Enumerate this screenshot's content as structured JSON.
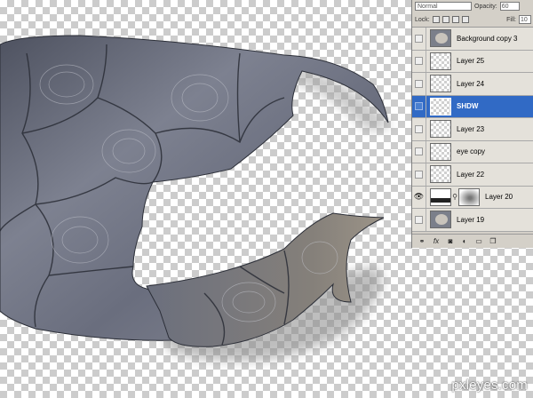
{
  "layers_panel": {
    "blend_mode": "Normal",
    "opacity_label": "Opacity:",
    "opacity_value": "60",
    "lock_label": "Lock:",
    "fill_label": "Fill:",
    "fill_value": "10",
    "layers": [
      {
        "name": "Background copy 3",
        "visible": false,
        "selected": false,
        "thumb": "photo"
      },
      {
        "name": "Layer 25",
        "visible": false,
        "selected": false,
        "thumb": "transparent"
      },
      {
        "name": "Layer 24",
        "visible": false,
        "selected": false,
        "thumb": "transparent"
      },
      {
        "name": "SHDW",
        "visible": false,
        "selected": true,
        "thumb": "transparent"
      },
      {
        "name": "Layer 23",
        "visible": false,
        "selected": false,
        "thumb": "transparent"
      },
      {
        "name": "eye copy",
        "visible": false,
        "selected": false,
        "thumb": "transparent"
      },
      {
        "name": "Layer 22",
        "visible": false,
        "selected": false,
        "thumb": "transparent"
      },
      {
        "name": "Layer 20",
        "visible": true,
        "selected": false,
        "thumb": "dark",
        "has_mask": true
      },
      {
        "name": "Layer 19",
        "visible": false,
        "selected": false,
        "thumb": "photo"
      }
    ],
    "bottom_icons": [
      "link-icon",
      "fx-icon",
      "mask-icon",
      "adjustment-icon",
      "folder-icon",
      "new-layer-icon"
    ]
  },
  "watermark": "pxleyes.com",
  "colors": {
    "selection": "#316ac5",
    "panel_bg": "#d4d0c8",
    "shell": "#5f6372"
  }
}
